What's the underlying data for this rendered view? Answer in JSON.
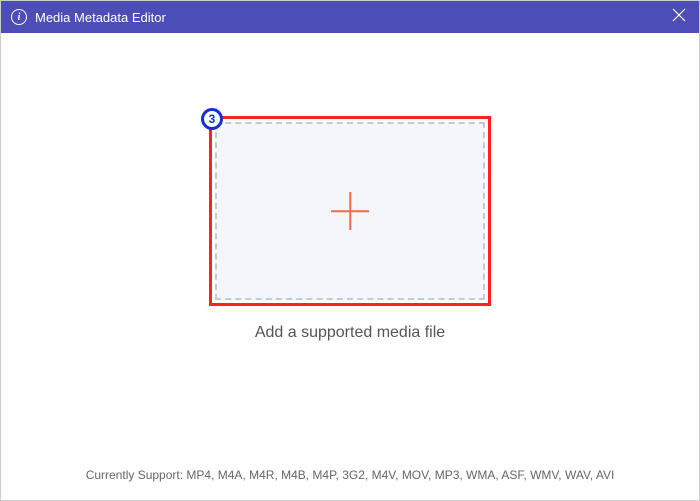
{
  "window": {
    "title": "Media Metadata Editor"
  },
  "dropzone": {
    "step_number": "3",
    "label": "Add a supported media file"
  },
  "footer": {
    "text": "Currently Support: MP4, M4A, M4R, M4B, M4P, 3G2, M4V, MOV, MP3, WMA, ASF, WMV, WAV, AVI"
  }
}
